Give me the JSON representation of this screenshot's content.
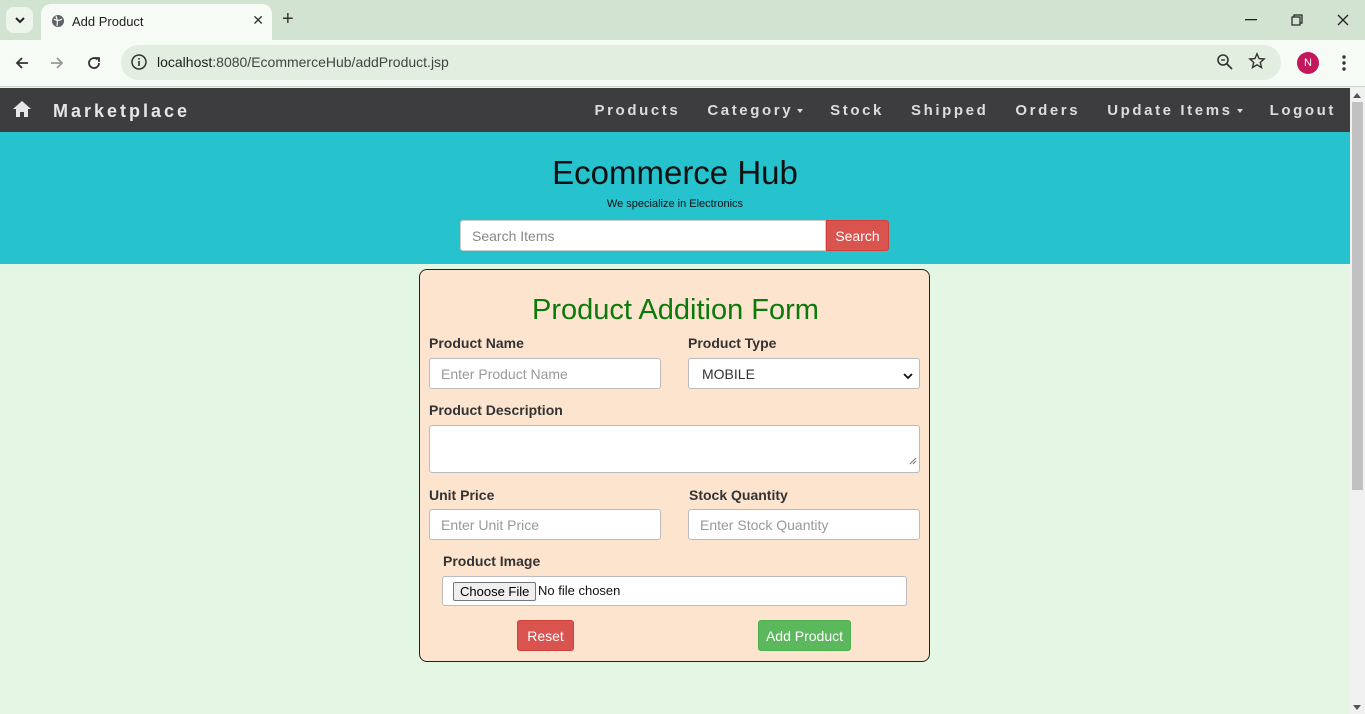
{
  "browser": {
    "tab_title": "Add Product",
    "url_host": "localhost",
    "url_rest": ":8080/EcommerceHub/addProduct.jsp",
    "profile_initial": "N"
  },
  "navbar": {
    "brand": "Marketplace",
    "items": [
      {
        "label": "Products",
        "dropdown": false
      },
      {
        "label": "Category",
        "dropdown": true
      },
      {
        "label": "Stock",
        "dropdown": false
      },
      {
        "label": "Shipped",
        "dropdown": false
      },
      {
        "label": "Orders",
        "dropdown": false
      },
      {
        "label": "Update Items",
        "dropdown": true
      },
      {
        "label": "Logout",
        "dropdown": false
      }
    ]
  },
  "hero": {
    "title": "Ecommerce Hub",
    "subtitle": "We specialize in Electronics",
    "search_placeholder": "Search Items",
    "search_button": "Search"
  },
  "form": {
    "title": "Product Addition Form",
    "product_name_label": "Product Name",
    "product_name_placeholder": "Enter Product Name",
    "product_type_label": "Product Type",
    "product_type_value": "MOBILE",
    "description_label": "Product Description",
    "unit_price_label": "Unit Price",
    "unit_price_placeholder": "Enter Unit Price",
    "stock_label": "Stock Quantity",
    "stock_placeholder": "Enter Stock Quantity",
    "image_label": "Product Image",
    "choose_file": "Choose File",
    "file_status": "No file chosen",
    "reset_button": "Reset",
    "add_button": "Add Product"
  },
  "colors": {
    "navbar_bg": "#3d3d3f",
    "hero_bg": "#26c2ce",
    "page_bg": "#e4f7e4",
    "form_bg": "#fde4cf",
    "form_title": "#0b7a0b",
    "danger": "#d9534f",
    "success": "#5cb85c"
  }
}
